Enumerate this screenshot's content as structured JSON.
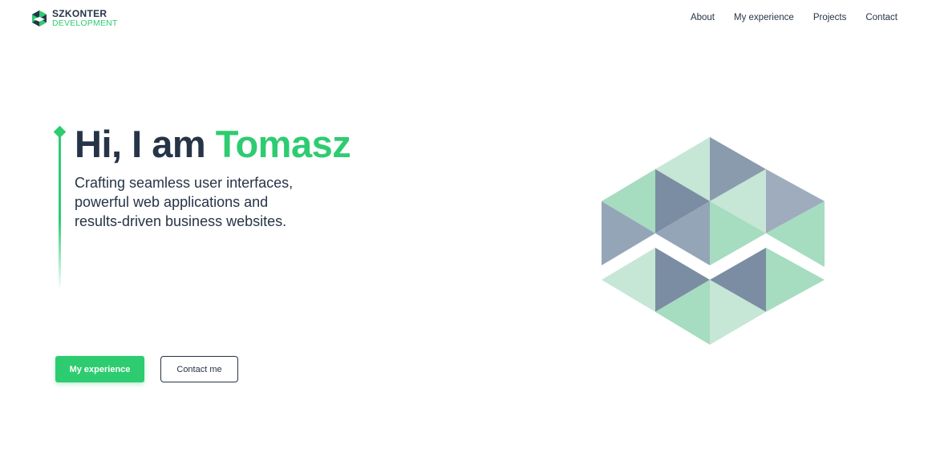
{
  "brand": {
    "name_top": "SZKONTER",
    "name_bottom": "DEVELOPMENT",
    "logo_icon": "hexagon-logo-icon"
  },
  "nav": {
    "items": [
      {
        "label": "About"
      },
      {
        "label": "My experience"
      },
      {
        "label": "Projects"
      },
      {
        "label": "Contact"
      }
    ]
  },
  "hero": {
    "greeting": "Hi, I am ",
    "name": "Tomasz",
    "subtitle_lines": [
      "Crafting seamless user interfaces,",
      "powerful web applications and",
      "results-driven business websites."
    ],
    "primary_button": "My experience",
    "secondary_button": "Contact me"
  },
  "colors": {
    "accent": "#2ecc71",
    "text_dark": "#263447",
    "background": "#ffffff"
  }
}
